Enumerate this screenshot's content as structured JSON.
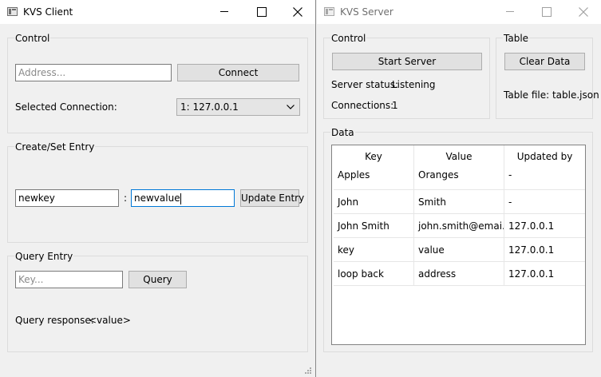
{
  "client": {
    "title": "KVS Client",
    "control": {
      "title": "Control",
      "address_placeholder": "Address...",
      "connect_label": "Connect",
      "selected_connection_label": "Selected Connection:",
      "selected_connection_value": "1: 127.0.0.1"
    },
    "create_set": {
      "title": "Create/Set Entry",
      "key_value": "newkey",
      "separator": ":",
      "value_value": "newvalue",
      "update_label": "Update Entry"
    },
    "query": {
      "title": "Query Entry",
      "key_placeholder": "Key...",
      "query_label": "Query",
      "response_label": "Query response:",
      "response_value": "<value>"
    }
  },
  "server": {
    "title": "KVS Server",
    "control": {
      "title": "Control",
      "start_label": "Start Server",
      "status_label": "Server status:",
      "status_value": "Listening",
      "connections_label": "Connections:",
      "connections_value": "1"
    },
    "table": {
      "title": "Table",
      "clear_label": "Clear Data",
      "file_label": "Table file: table.json"
    },
    "data": {
      "title": "Data",
      "columns": [
        "Key",
        "Value",
        "Updated by"
      ],
      "rows": [
        [
          "Apples",
          "Oranges",
          "-"
        ],
        [
          "John",
          "Smith",
          "-"
        ],
        [
          "John Smith",
          "john.smith@emai...",
          "127.0.0.1"
        ],
        [
          "key",
          "value",
          "127.0.0.1"
        ],
        [
          "loop back",
          "address",
          "127.0.0.1"
        ]
      ]
    }
  }
}
